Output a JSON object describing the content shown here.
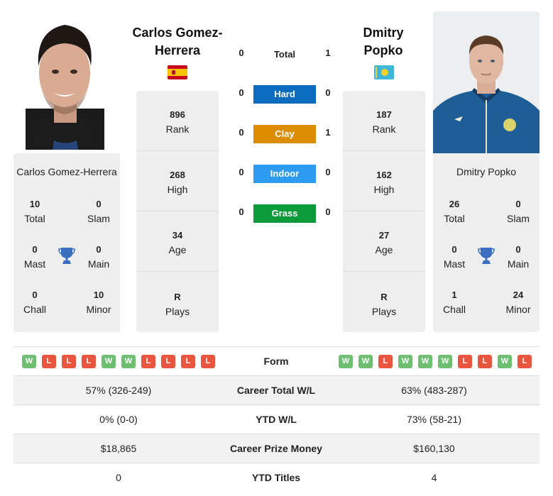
{
  "player_left": {
    "name": "Carlos Gomez-Herrera",
    "name_line1": "Carlos Gomez-",
    "name_line2": "Herrera",
    "flag": "Spain",
    "photo": "player-photo",
    "rank": {
      "value": "896",
      "label": "Rank"
    },
    "high": {
      "value": "268",
      "label": "High"
    },
    "age": {
      "value": "34",
      "label": "Age"
    },
    "plays": {
      "value": "R",
      "label": "Plays"
    },
    "titles": {
      "total": {
        "value": "10",
        "label": "Total"
      },
      "slam": {
        "value": "0",
        "label": "Slam"
      },
      "mast": {
        "value": "0",
        "label": "Mast"
      },
      "main": {
        "value": "0",
        "label": "Main"
      },
      "chall": {
        "value": "0",
        "label": "Chall"
      },
      "minor": {
        "value": "10",
        "label": "Minor"
      }
    },
    "form": [
      "W",
      "L",
      "L",
      "L",
      "W",
      "W",
      "L",
      "L",
      "L",
      "L"
    ]
  },
  "player_right": {
    "name": "Dmitry Popko",
    "name_line1": "Dmitry",
    "name_line2": "Popko",
    "flag": "Kazakhstan",
    "photo": "player-photo",
    "rank": {
      "value": "187",
      "label": "Rank"
    },
    "high": {
      "value": "162",
      "label": "High"
    },
    "age": {
      "value": "27",
      "label": "Age"
    },
    "plays": {
      "value": "R",
      "label": "Plays"
    },
    "titles": {
      "total": {
        "value": "26",
        "label": "Total"
      },
      "slam": {
        "value": "0",
        "label": "Slam"
      },
      "mast": {
        "value": "0",
        "label": "Mast"
      },
      "main": {
        "value": "0",
        "label": "Main"
      },
      "chall": {
        "value": "1",
        "label": "Chall"
      },
      "minor": {
        "value": "24",
        "label": "Minor"
      }
    },
    "form": [
      "W",
      "W",
      "L",
      "W",
      "W",
      "W",
      "L",
      "L",
      "W",
      "L"
    ]
  },
  "h2h": {
    "total": {
      "label": "Total",
      "left": "0",
      "right": "1"
    },
    "surfaces": [
      {
        "label": "Hard",
        "left": "0",
        "right": "0",
        "color": "#0a6bbf"
      },
      {
        "label": "Clay",
        "left": "0",
        "right": "1",
        "color": "#db8c00"
      },
      {
        "label": "Indoor",
        "left": "0",
        "right": "0",
        "color": "#2d9cf0"
      },
      {
        "label": "Grass",
        "left": "0",
        "right": "0",
        "color": "#0d9a3a"
      }
    ]
  },
  "comparison": {
    "form_label": "Form",
    "rows": [
      {
        "label": "Career Total W/L",
        "left": "57% (326-249)",
        "right": "63% (483-287)"
      },
      {
        "label": "YTD W/L",
        "left": "0% (0-0)",
        "right": "73% (58-21)"
      },
      {
        "label": "Career Prize Money",
        "left": "$18,865",
        "right": "$160,130"
      },
      {
        "label": "YTD Titles",
        "left": "0",
        "right": "4"
      }
    ]
  },
  "icons": {
    "trophy": "trophy-icon"
  },
  "colors": {
    "win": "#6fbf73",
    "loss": "#e8563f",
    "card_bg": "#eeeeee",
    "trophy": "#3a6fc0"
  }
}
